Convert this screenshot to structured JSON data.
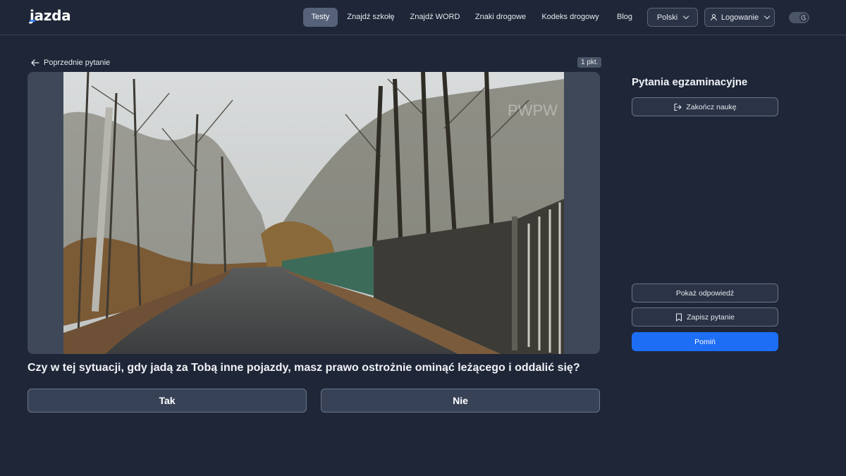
{
  "header": {
    "logo": "jazda",
    "nav": [
      {
        "label": "Testy",
        "active": true
      },
      {
        "label": "Znajdź szkołę",
        "active": false
      },
      {
        "label": "Znajdź WORD",
        "active": false
      },
      {
        "label": "Znaki drogowe",
        "active": false
      },
      {
        "label": "Kodeks drogowy",
        "active": false
      },
      {
        "label": "Blog",
        "active": false
      }
    ],
    "language": "Polski",
    "login": "Logowanie",
    "theme_toggle": "dark-mode"
  },
  "main": {
    "prev_link": "Poprzednie pytanie",
    "points": "1 pkt.",
    "media_description": "road-scene-image",
    "question": "Czy w tej sytuacji, gdy jadą za Tobą inne pojazdy, masz prawo ostrożnie ominąć leżącego i oddalić się?",
    "answers": [
      "Tak",
      "Nie"
    ]
  },
  "sidebar": {
    "title": "Pytania egzaminacyjne",
    "end_learning": "Zakończ naukę",
    "show_answer": "Pokaż odpowiedź",
    "save_question": "Zapisz pytanie",
    "skip": "Pomiń"
  },
  "colors": {
    "background": "#1e2637",
    "accent": "#1d6ef5",
    "active_nav": "#56627a"
  }
}
